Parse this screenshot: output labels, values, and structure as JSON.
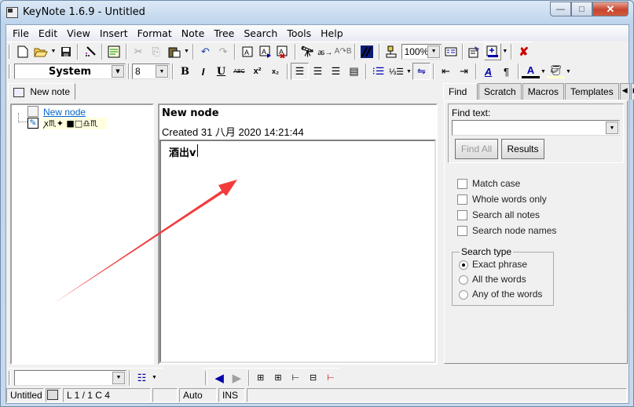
{
  "window": {
    "title": "KeyNote 1.6.9 - Untitled",
    "controls": {
      "minimize": "—",
      "maximize": "□",
      "close": "✕"
    }
  },
  "menu": [
    "File",
    "Edit",
    "View",
    "Insert",
    "Format",
    "Note",
    "Tree",
    "Search",
    "Tools",
    "Help"
  ],
  "toolbar_main": {
    "icons": [
      "new-file-icon",
      "open-folder-icon",
      "save-icon",
      "magic-wand-icon",
      "template-icon",
      "cut-icon",
      "copy-icon",
      "paste-icon",
      "undo-icon",
      "redo-icon",
      "new-note-icon",
      "rename-note-icon",
      "delete-note-icon",
      "find-icon",
      "find-next-icon",
      "find-replace-icon",
      "style-icon",
      "pin-icon",
      "options-icon",
      "properties-icon",
      "resource-panel-icon",
      "exit-icon"
    ],
    "zoom_value": "100%"
  },
  "toolbar_format": {
    "font_name": "System",
    "font_size": "8",
    "bold": "B",
    "italic": "I",
    "underline": "U",
    "strike": "ABC",
    "superscript": "x²",
    "subscript": "x₂"
  },
  "note_tabs": [
    {
      "label": "New note",
      "icon": "note-tab-icon"
    }
  ],
  "tree": {
    "nodes": [
      {
        "label": "New node",
        "selected": true
      },
      {
        "label": "ꭗ♏✦ ■□♎♏",
        "editing": true
      }
    ]
  },
  "editor": {
    "node_title": "New node",
    "created": "Created 31 八月 2020 14:21:44",
    "content": "酒出v"
  },
  "right_panel": {
    "tabs": [
      "Find",
      "Scratch",
      "Macros",
      "Templates"
    ],
    "active_tab": "Find",
    "find_text_label": "Find text:",
    "find_text_value": "",
    "find_all_label": "Find All",
    "results_label": "Results",
    "options": [
      {
        "label": "Match case",
        "checked": false
      },
      {
        "label": "Whole words only",
        "checked": false
      },
      {
        "label": "Search all notes",
        "checked": false
      },
      {
        "label": "Search node names",
        "checked": false
      }
    ],
    "search_type": {
      "label": "Search type",
      "options": [
        {
          "label": "Exact phrase",
          "selected": true
        },
        {
          "label": "All the words",
          "selected": false
        },
        {
          "label": "Any of the words",
          "selected": false
        }
      ]
    }
  },
  "bottom_toolbar": {
    "style_value": ""
  },
  "status_bar": {
    "file": "Untitled",
    "position": "L 1 / 1  C 4",
    "blank": "",
    "mode": "Auto",
    "insert": "INS"
  },
  "annotation": {
    "color": "#f23c3c"
  }
}
